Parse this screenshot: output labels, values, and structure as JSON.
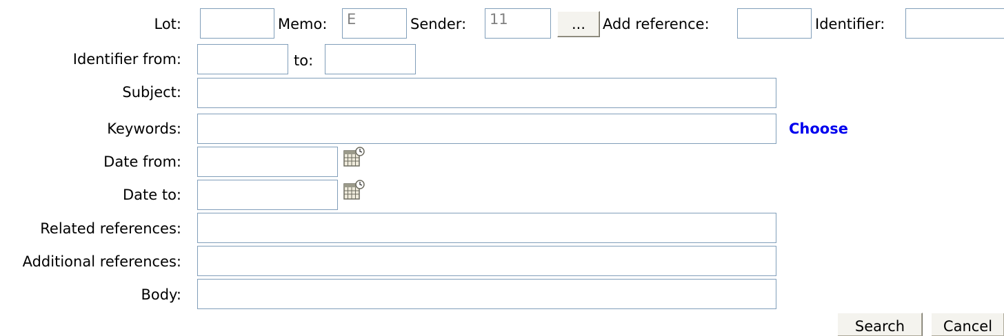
{
  "form": {
    "lot": {
      "label": "Lot:",
      "value": ""
    },
    "memo": {
      "label": "Memo:",
      "value": "E"
    },
    "sender": {
      "label": "Sender:",
      "value": "11"
    },
    "sender_pick_label": "...",
    "add_reference": {
      "label": "Add reference:",
      "value": ""
    },
    "identifier": {
      "label": "Identifier:",
      "value": ""
    },
    "identifier_from": {
      "label": "Identifier from:",
      "value": ""
    },
    "identifier_to": {
      "label": "to:",
      "value": ""
    },
    "subject": {
      "label": "Subject:",
      "value": ""
    },
    "keywords": {
      "label": "Keywords:",
      "value": "",
      "choose_label": "Choose"
    },
    "date_from": {
      "label": "Date from:",
      "value": "",
      "icon": "calendar-icon"
    },
    "date_to": {
      "label": "Date to:",
      "value": "",
      "icon": "calendar-icon"
    },
    "related_references": {
      "label": "Related references:",
      "value": ""
    },
    "additional_references": {
      "label": "Additional references:",
      "value": ""
    },
    "body": {
      "label": "Body:",
      "value": ""
    }
  },
  "actions": {
    "search_label": "Search",
    "cancel_label": "Cancel"
  },
  "colors": {
    "input_border": "#7f9db9",
    "link": "#0000ee",
    "button_face": "#f4f3ee"
  }
}
